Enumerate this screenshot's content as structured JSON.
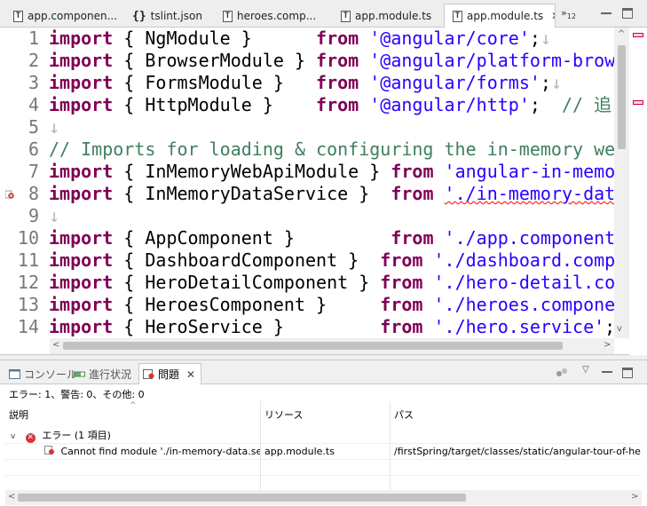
{
  "editor_tabs": [
    {
      "label": "app.componen...",
      "icon": "typescript-file-icon"
    },
    {
      "label": "tslint.json",
      "icon": "json-file-icon"
    },
    {
      "label": "heroes.comp...",
      "icon": "typescript-file-icon"
    },
    {
      "label": "app.module.ts",
      "icon": "typescript-file-icon"
    },
    {
      "label": "app.module.ts",
      "icon": "typescript-file-icon",
      "active": true
    }
  ],
  "tab_overflow": {
    "label": "»",
    "count": "12"
  },
  "editor": {
    "eol_marker": "↓",
    "lines": [
      {
        "n": "1",
        "kw1": "import",
        "p1": " { NgModule }      ",
        "kw2": "from",
        "p2": " ",
        "str": "'@angular/core'",
        "rest": ";",
        "eol": "↓"
      },
      {
        "n": "2",
        "kw1": "import",
        "p1": " { BrowserModule } ",
        "kw2": "from",
        "p2": " ",
        "str": "'@angular/platform-brows",
        "rest": "",
        "eol": ""
      },
      {
        "n": "3",
        "kw1": "import",
        "p1": " { FormsModule }   ",
        "kw2": "from",
        "p2": " ",
        "str": "'@angular/forms'",
        "rest": ";",
        "eol": "↓"
      },
      {
        "n": "4",
        "kw1": "import",
        "p1": " { HttpModule }    ",
        "kw2": "from",
        "p2": " ",
        "str": "'@angular/http'",
        "rest": ";  ",
        "cm": "// 追",
        "eol": ""
      },
      {
        "n": "5",
        "blank": true,
        "eol": "↓"
      },
      {
        "n": "6",
        "comment_line": "// Imports for loading & configuring the in-memory web"
      },
      {
        "n": "7",
        "kw1": "import",
        "p1": " { InMemoryWebApiModule } ",
        "kw2": "from",
        "p2": " ",
        "str": "'angular-in-memo",
        "rest": "",
        "eol": ""
      },
      {
        "n": "8",
        "kw1": "import",
        "p1": " { InMemoryDataService }  ",
        "kw2": "from",
        "p2": " ",
        "str": "'./in-memory-data",
        "rest": "",
        "eol": "",
        "error": true
      },
      {
        "n": "9",
        "blank": true,
        "eol": "↓"
      },
      {
        "n": "10",
        "kw1": "import",
        "p1": " { AppComponent }         ",
        "kw2": "from",
        "p2": " ",
        "str": "'./app.component'",
        "rest": " ",
        "eol": ""
      },
      {
        "n": "11",
        "kw1": "import",
        "p1": " { DashboardComponent }  ",
        "kw2": "from",
        "p2": " ",
        "str": "'./dashboard.compo",
        "rest": "",
        "eol": ""
      },
      {
        "n": "12",
        "kw1": "import",
        "p1": " { HeroDetailComponent } ",
        "kw2": "from",
        "p2": " ",
        "str": "'./hero-detail.com",
        "rest": "",
        "eol": ""
      },
      {
        "n": "13",
        "kw1": "import",
        "p1": " { HeroesComponent }     ",
        "kw2": "from",
        "p2": " ",
        "str": "'./heroes.componen",
        "rest": "",
        "eol": ""
      },
      {
        "n": "14",
        "kw1": "import",
        "p1": " { HeroService }         ",
        "kw2": "from",
        "p2": " ",
        "str": "'./hero.service'",
        "rest": ";",
        "eol": ""
      }
    ]
  },
  "panel": {
    "tabs": [
      {
        "label": "コンソール",
        "icon": "console-icon"
      },
      {
        "label": "進行状況",
        "icon": "progress-icon"
      },
      {
        "label": "問題",
        "icon": "problems-icon",
        "active": true
      }
    ],
    "summary": "エラー: 1、警告: 0、その他: 0",
    "columns": [
      "説明",
      "リソース",
      "パス"
    ],
    "group": {
      "label": "エラー (1 項目)"
    },
    "problem": {
      "description": "Cannot find module './in-memory-data.ser",
      "resource": "app.module.ts",
      "path": "/firstSpring/target/classes/static/angular-tour-of-her"
    }
  },
  "colors": {
    "keyword": "#7f0055",
    "string": "#2a00ff",
    "comment": "#3f7f5f",
    "error": "#d63333"
  }
}
